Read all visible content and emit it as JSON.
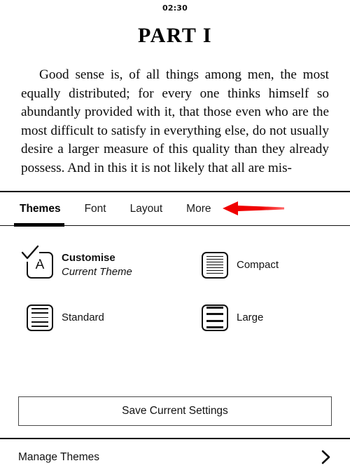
{
  "status_bar": {
    "time": "02:30"
  },
  "reader": {
    "chapter_title": "PART I",
    "body_text": "Good sense is, of all things among men, the most equally distributed; for every one thinks himself so abundantly provided with it, that those even who are the most difficult to satisfy in everything else, do not usually desire a larger measure of this quality than they already possess. And in this it is not likely that all are mis-"
  },
  "panel": {
    "tabs": [
      {
        "label": "Themes",
        "active": true
      },
      {
        "label": "Font",
        "active": false
      },
      {
        "label": "Layout",
        "active": false
      },
      {
        "label": "More",
        "active": false
      }
    ],
    "themes": [
      {
        "name": "Customise",
        "sub": "Current Theme",
        "icon": "letter-a-check-icon",
        "selected": true
      },
      {
        "name": "Compact",
        "sub": "",
        "icon": "compact-lines-icon",
        "selected": false
      },
      {
        "name": "Standard",
        "sub": "",
        "icon": "standard-lines-icon",
        "selected": false
      },
      {
        "name": "Large",
        "sub": "",
        "icon": "large-lines-icon",
        "selected": false
      }
    ],
    "save_button_label": "Save Current Settings",
    "manage_row_label": "Manage Themes",
    "manage_row_icon": "chevron-right-icon"
  },
  "annotation": {
    "type": "arrow",
    "color": "#f00000",
    "direction": "left",
    "points_at": "More"
  }
}
